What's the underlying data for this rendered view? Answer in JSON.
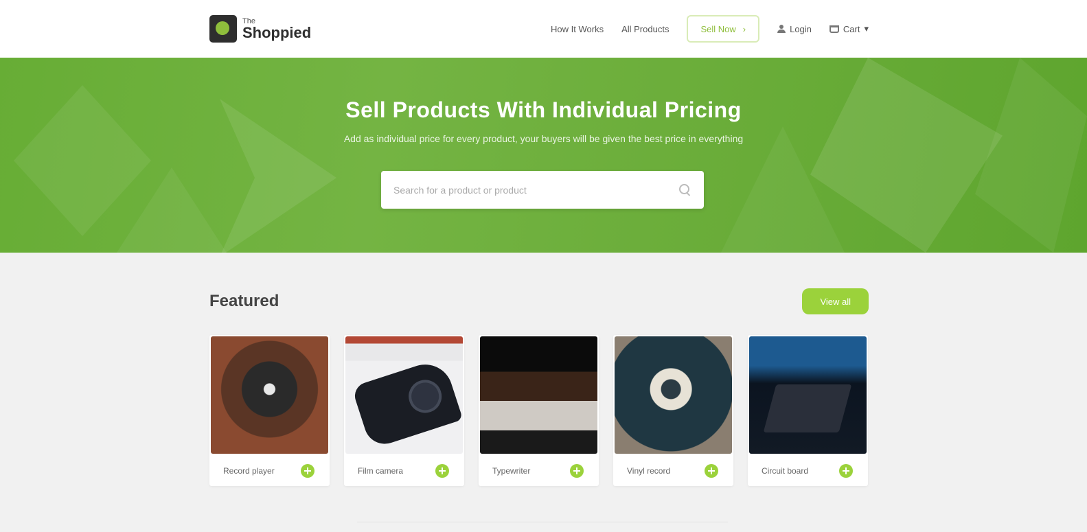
{
  "logo": {
    "small": "The",
    "big": "Shoppied"
  },
  "nav": {
    "links": [
      "How It Works",
      "All Products"
    ],
    "cta_label": "Sell Now",
    "cta_arrow": "›",
    "login_label": "Login",
    "cart_label": "Cart",
    "cart_caret": "▾"
  },
  "hero": {
    "title": "Sell Products With Individual Pricing",
    "subtitle": "Add as individual price for every product, your buyers will be given the best price in everything",
    "search_placeholder": "Search for a product or product"
  },
  "featured": {
    "title": "Featured",
    "view_all_label": "View all"
  },
  "products": [
    {
      "name": "Record player",
      "image": "turntable-photo"
    },
    {
      "name": "Film camera",
      "image": "camera-photo"
    },
    {
      "name": "Typewriter",
      "image": "typewriter-photo"
    },
    {
      "name": "Vinyl record",
      "image": "vinyl-photo"
    },
    {
      "name": "Circuit board",
      "image": "circuit-photo"
    }
  ],
  "colors": {
    "accent": "#9bd23b",
    "hero_green": "#6cae3b",
    "header_bg": "#ffffff",
    "page_bg": "#f1f1f1"
  }
}
